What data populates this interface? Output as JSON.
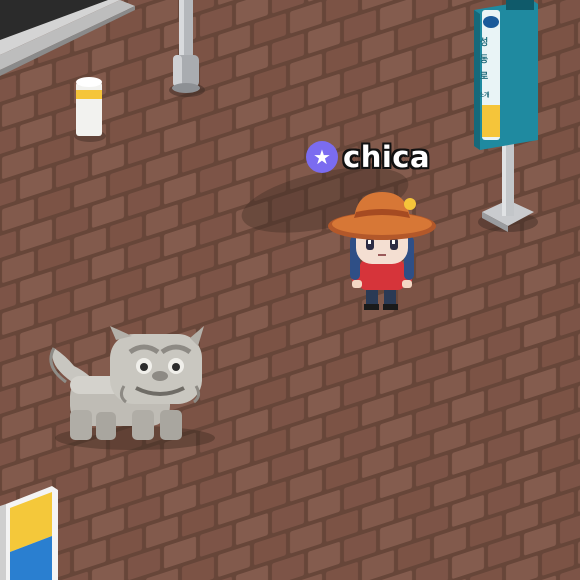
{
  "player": {
    "name": "chica",
    "badge": "star-icon"
  },
  "signpost": {
    "chars": [
      "성",
      "동",
      "로"
    ],
    "sub": "소개"
  },
  "colors": {
    "ground": "#7a5446",
    "brick": "#8c6152",
    "badge": "#7b6cf0",
    "sign": "#1f8aa0"
  }
}
